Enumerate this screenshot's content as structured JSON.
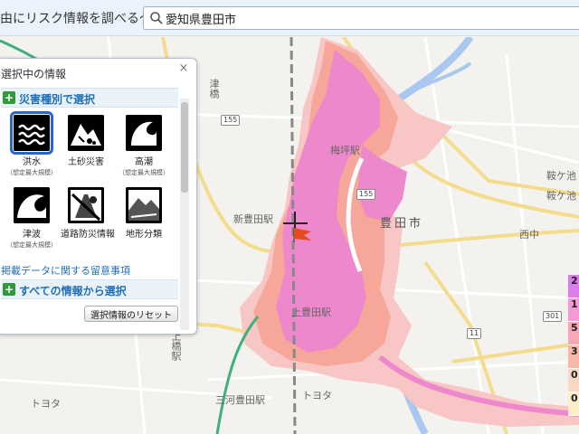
{
  "header": {
    "title": "由にリスク情報を調べる～",
    "search": {
      "value": "愛知県豊田市",
      "placeholder": ""
    }
  },
  "map": {
    "labels": {
      "tsubashi": "津橋",
      "shintoyota": "新豊田駅",
      "toyota_city": "豊田市",
      "kamitoyota": "上豊田駅",
      "mikawa_toyota": "三河豊田駅",
      "toyota1": "トヨタ",
      "toyota2": "トヨタ",
      "uehashi": "上橋駅",
      "nishinaka": "西中",
      "umetsubo": "梅坪駅",
      "kuragae": "鞍ケ池",
      "kuragae2": "鞍ケ池"
    },
    "route_numbers": [
      "155",
      "155",
      "11",
      "301"
    ],
    "legend_values": [
      "2",
      "1",
      "5",
      "3",
      "0",
      "0"
    ],
    "colors": {
      "flood_pink": "#ee88cc",
      "flood_salmon": "#f7a79a",
      "flood_light": "#f8c6c4",
      "river": "#a8c8f0",
      "road_yellow": "#f3dd8c",
      "highway_green": "#3fb07a"
    }
  },
  "panel": {
    "title": "選択中の情報",
    "close_label": "×",
    "section_disaster": {
      "icon": "+",
      "label": "災害種別で選択"
    },
    "hazards": [
      {
        "name": "洪水",
        "note": "（想定最大規模）",
        "icon": "flood-icon",
        "selected": true
      },
      {
        "name": "土砂災害",
        "note": "",
        "icon": "landslide-icon",
        "selected": false
      },
      {
        "name": "高潮",
        "note": "（想定最大規模）",
        "icon": "storm-surge-icon",
        "selected": false
      },
      {
        "name": "津波",
        "note": "（想定最大規模）",
        "icon": "tsunami-icon",
        "selected": false
      },
      {
        "name": "道路防災情報",
        "note": "",
        "icon": "road-disaster-icon",
        "selected": false
      },
      {
        "name": "地形分類",
        "note": "",
        "icon": "landform-icon",
        "selected": false
      }
    ],
    "notes_link": "掲載データに関する留意事項",
    "section_all": {
      "icon": "+",
      "label": "すべての情報から選択"
    },
    "reset_label": "選択情報のリセット"
  }
}
